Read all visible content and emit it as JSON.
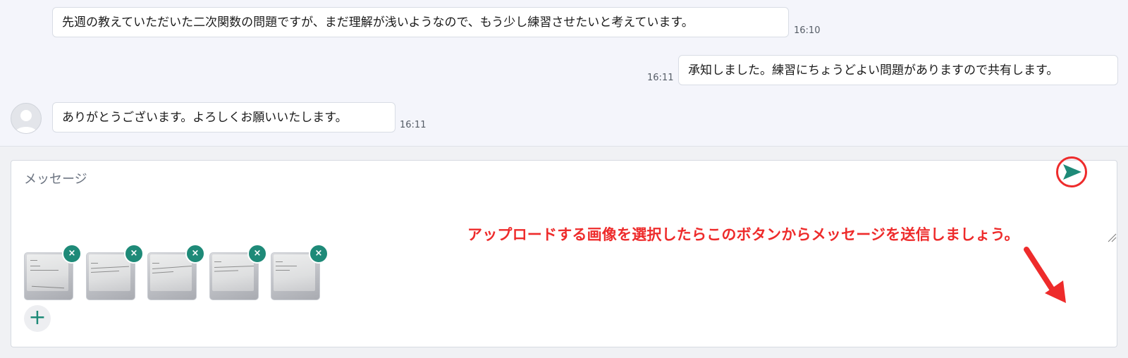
{
  "messages": [
    {
      "text": "先週の教えていただいた二次関数の問題ですが、まだ理解が浅いようなので、もう少し練習させたいと考えています。",
      "time": "16:10",
      "side": "left"
    },
    {
      "text": "承知しました。練習にちょうどよい問題がありますので共有します。",
      "time": "16:11",
      "side": "right"
    },
    {
      "text": "ありがとうございます。よろしくお願いいたします。",
      "time": "16:11",
      "side": "left"
    }
  ],
  "composer": {
    "placeholder": "メッセージ",
    "attachments_count": 5,
    "remove_icon": "×",
    "add_icon": "+",
    "send_icon": "paper-plane-icon"
  },
  "annotation": {
    "text": "アップロードする画像を選択したらこのボタンからメッセージを送信しましょう。",
    "color": "#ee2b2b"
  },
  "colors": {
    "accent": "#1e8a78",
    "annotation": "#ee2b2b",
    "chat_bg": "#f4f5fb"
  }
}
